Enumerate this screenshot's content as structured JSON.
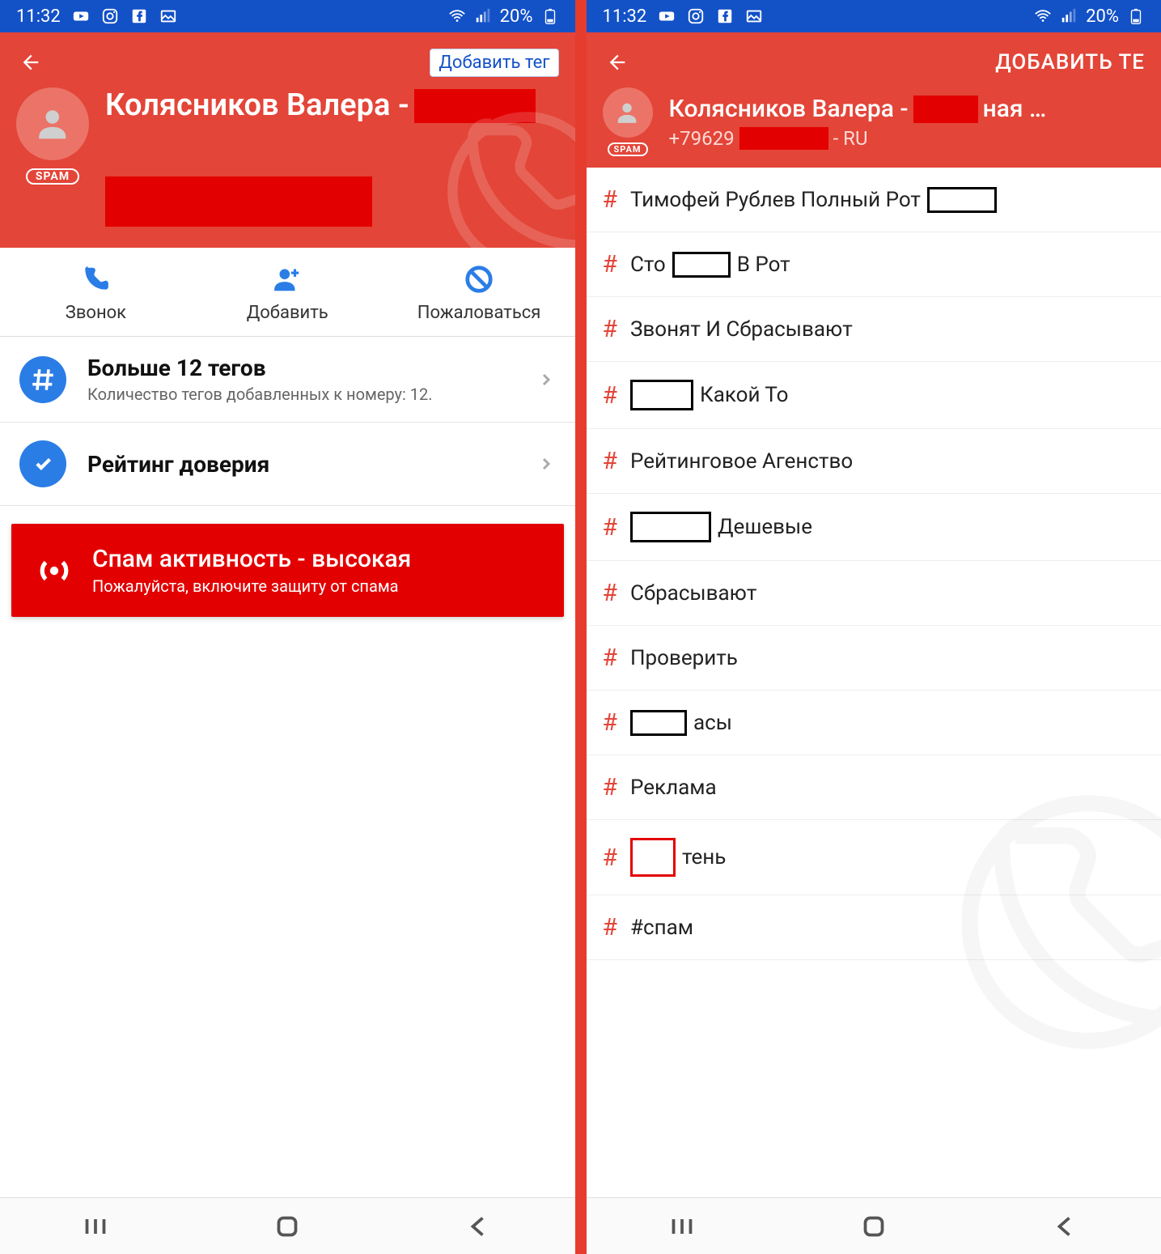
{
  "statusbar": {
    "time": "11:32",
    "battery": "20%"
  },
  "left": {
    "add_tag": "Добавить тег",
    "name_prefix": "Колясников Валера -",
    "spam_label": "SPAM",
    "actions": {
      "call": "Звонок",
      "add": "Добавить",
      "report": "Пожаловаться"
    },
    "tags_row": {
      "title": "Больше 12 тегов",
      "subtitle": "Количество тегов добавленных к номеру: 12."
    },
    "trust_row": {
      "title": "Рейтинг доверия"
    },
    "banner": {
      "title": "Спам активность - высокая",
      "subtitle": "Пожалуйста, включите защиту от спама"
    }
  },
  "right": {
    "add_tag": "ДОБАВИТЬ ТЕ",
    "name_prefix": "Колясников Валера -",
    "name_suffix": "ная …",
    "phone_prefix": "+79629",
    "phone_suffix": "- RU",
    "spam_label": "SPAM",
    "tags": [
      {
        "pre": "Тимофей Рублев Полный Рот",
        "box": "b1",
        "post": ""
      },
      {
        "pre": "Сто",
        "box": "b2",
        "post": "В Рот"
      },
      {
        "pre": "Звонят И Сбрасывают",
        "box": "",
        "post": ""
      },
      {
        "pre": "",
        "box": "b3",
        "post": "Какой То"
      },
      {
        "pre": "Рейтинговое Агенство",
        "box": "",
        "post": ""
      },
      {
        "pre": "",
        "box": "b4",
        "post": "Дешевые"
      },
      {
        "pre": "Сбрасывают",
        "box": "",
        "post": ""
      },
      {
        "pre": "Проверить",
        "box": "",
        "post": ""
      },
      {
        "pre": "",
        "box": "b5",
        "post": "асы"
      },
      {
        "pre": "Реклама",
        "box": "",
        "post": ""
      },
      {
        "pre": "",
        "box": "red",
        "post": "тень"
      },
      {
        "pre": "#спам",
        "box": "",
        "post": ""
      }
    ]
  }
}
